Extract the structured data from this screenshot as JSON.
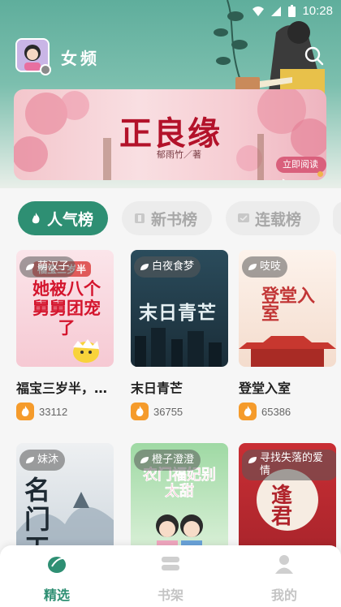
{
  "status_bar": {
    "time": "10:28"
  },
  "header": {
    "channel_title": "女频",
    "search_icon": "search-icon",
    "avatar_icon": "avatar"
  },
  "banner": {
    "title": "正良缘",
    "author": "郁雨竹／著",
    "cta": "立即阅读 ▸"
  },
  "tabs": [
    {
      "label": "人气榜",
      "icon": "flame-icon",
      "active": true
    },
    {
      "label": "新书榜",
      "icon": "book-icon",
      "active": false
    },
    {
      "label": "连载榜",
      "icon": "serial-icon",
      "active": false
    }
  ],
  "books": [
    {
      "tag": "萌汉子",
      "title": "福宝三岁半，…",
      "count": "33112",
      "cover_text": "她被八个舅舅团宠了",
      "cover_sub": "福宝三岁半"
    },
    {
      "tag": "白夜食梦",
      "title": "末日青芒",
      "count": "36755",
      "cover_text": "末日青芒"
    },
    {
      "tag": "吱吱",
      "title": "登堂入室",
      "count": "65386",
      "cover_text": "登堂入室"
    },
    {
      "tag": "妹沐",
      "title": "",
      "count": "",
      "cover_text": "名门天机"
    },
    {
      "tag": "橙子澄澄",
      "title": "",
      "count": "",
      "cover_text": "农门福妃别太甜"
    },
    {
      "tag": "寻找失落的爱情",
      "title": "",
      "count": "",
      "cover_text": "逢君"
    }
  ],
  "bottom_nav": [
    {
      "label": "精选",
      "active": true
    },
    {
      "label": "书架",
      "active": false
    },
    {
      "label": "我的",
      "active": false
    }
  ],
  "colors": {
    "accent": "#2e8f73",
    "header": "#5fae9c",
    "fire": "#f59b2b"
  }
}
